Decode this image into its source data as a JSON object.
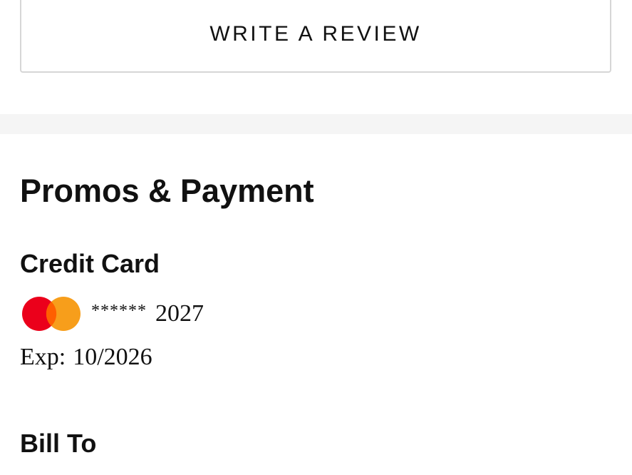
{
  "review": {
    "button_label": "WRITE A REVIEW"
  },
  "payment_section": {
    "title": "Promos & Payment",
    "credit_card": {
      "heading": "Credit Card",
      "brand_icon": "mastercard-logo-icon",
      "mask": "******",
      "last_digits": "2027",
      "exp_label": "Exp:",
      "exp_value": "10/2026"
    }
  },
  "bill_to": {
    "heading": "Bill To"
  },
  "colors": {
    "mastercard_red": "#eb001b",
    "mastercard_orange": "#f79e1b",
    "mastercard_overlap": "#ff5f00",
    "band": "#f5f5f5",
    "border": "#d6d6d6"
  }
}
